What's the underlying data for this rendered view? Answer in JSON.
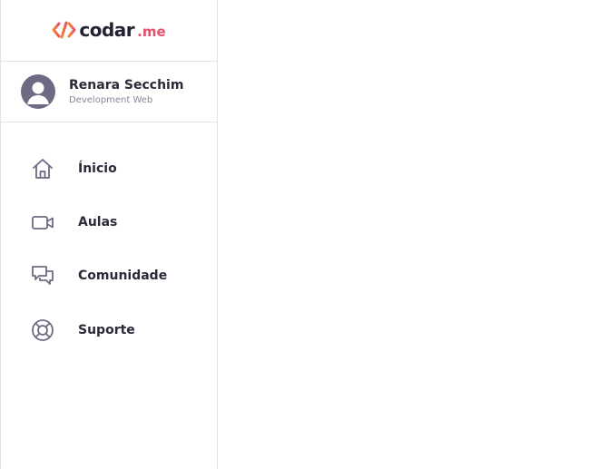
{
  "brand": {
    "name": "codar",
    "tld": ".me",
    "colors": {
      "accent_start": "#f08a2c",
      "accent_end": "#e8506b",
      "text": "#222233"
    },
    "icon": "code-brackets-icon"
  },
  "user": {
    "name": "Renara Secchim",
    "role": "Development Web",
    "avatar_icon": "user-avatar-icon"
  },
  "nav": {
    "items": [
      {
        "label": "Ínicio",
        "icon": "home-icon"
      },
      {
        "label": "Aulas",
        "icon": "video-camera-icon"
      },
      {
        "label": "Comunidade",
        "icon": "chat-bubbles-icon"
      },
      {
        "label": "Suporte",
        "icon": "lifebuoy-icon"
      }
    ]
  }
}
